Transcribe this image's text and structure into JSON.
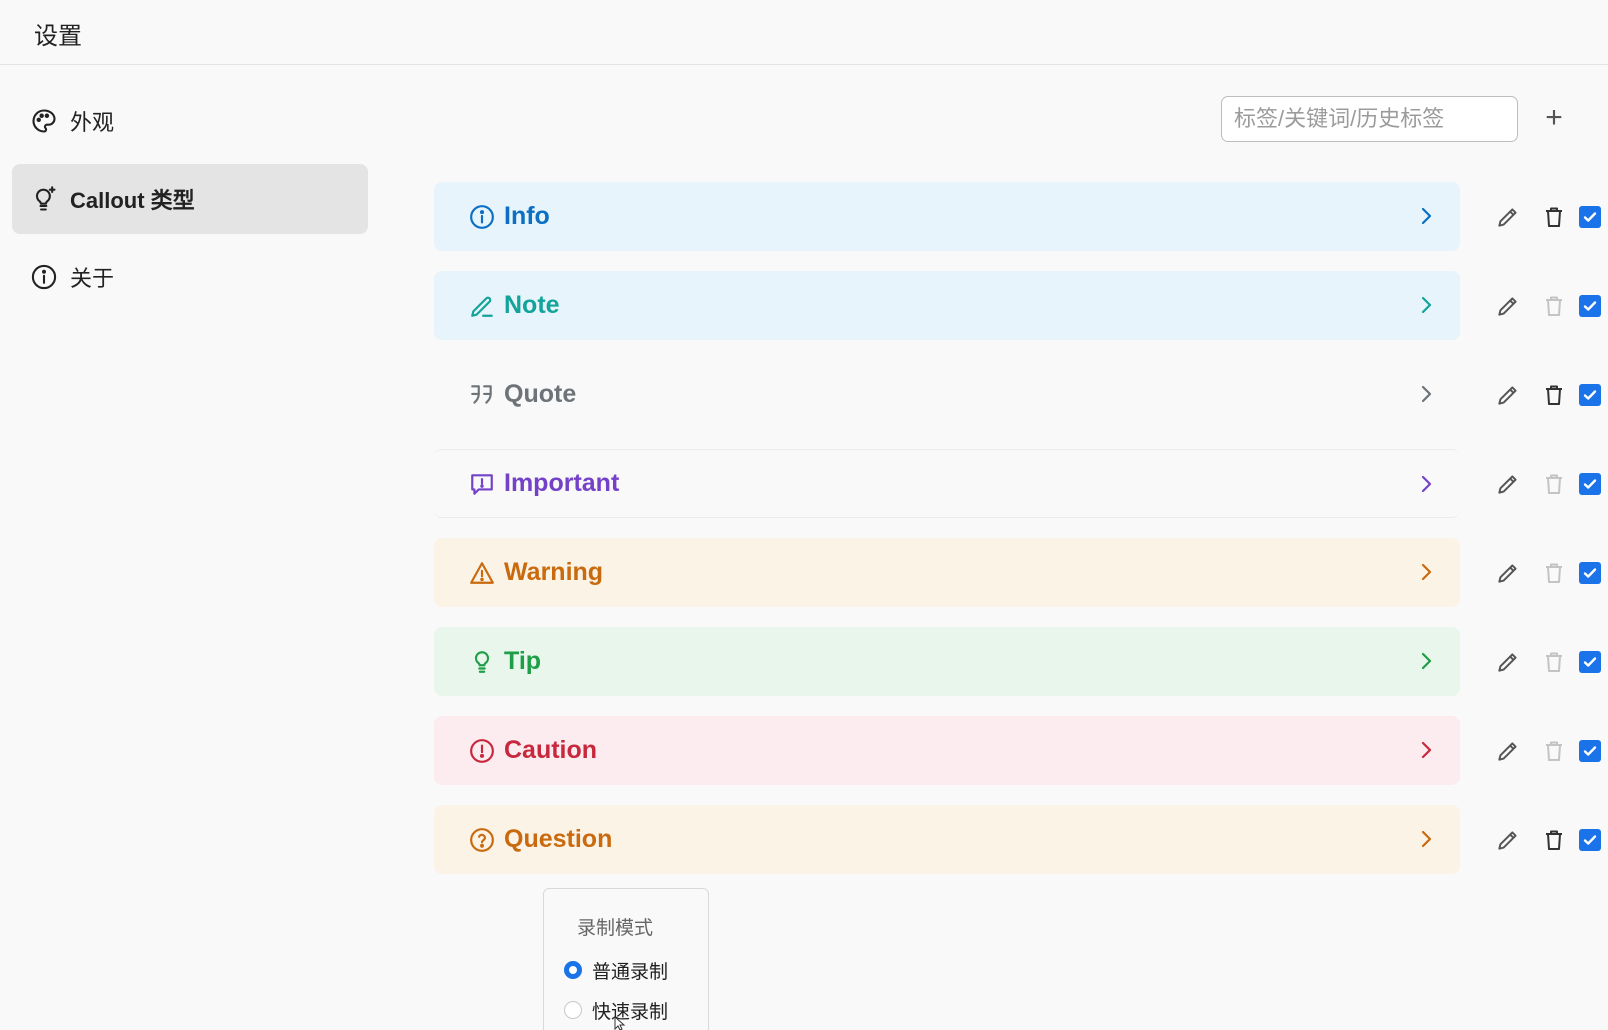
{
  "window": {
    "title": "设置"
  },
  "sidebar": {
    "items": [
      {
        "label": "外观",
        "icon": "palette-icon",
        "active": false
      },
      {
        "label": "Callout 类型",
        "icon": "lightbulb-sparkle-icon",
        "active": true
      },
      {
        "label": "关于",
        "icon": "info-icon",
        "active": false
      }
    ]
  },
  "search": {
    "placeholder": "标签/关键词/历史标签",
    "value": ""
  },
  "add_button": {
    "label": "+"
  },
  "callouts": [
    {
      "label": "Info",
      "icon": "info-circle-icon",
      "color": "#0b6fc4",
      "bg": "#e7f4fb",
      "delete_enabled": true,
      "checked": true
    },
    {
      "label": "Note",
      "icon": "pencil-icon",
      "color": "#12a39a",
      "bg": "#e7f4fb",
      "delete_enabled": false,
      "checked": true
    },
    {
      "label": "Quote",
      "icon": "quote-icon",
      "color": "#6d7378",
      "bg": "#f9f9f9",
      "delete_enabled": true,
      "checked": true
    },
    {
      "label": "Important",
      "icon": "message-alert-icon",
      "color": "#7442c8",
      "bg": "#f9f9f9",
      "delete_enabled": false,
      "checked": true
    },
    {
      "label": "Warning",
      "icon": "warning-triangle-icon",
      "color": "#c96a0e",
      "bg": "#fcf3e7",
      "delete_enabled": false,
      "checked": true
    },
    {
      "label": "Tip",
      "icon": "lightbulb-icon",
      "color": "#1e9e47",
      "bg": "#e9f6ec",
      "delete_enabled": false,
      "checked": true
    },
    {
      "label": "Caution",
      "icon": "alert-circle-icon",
      "color": "#c8283d",
      "bg": "#fcecef",
      "delete_enabled": false,
      "checked": true
    },
    {
      "label": "Question",
      "icon": "question-circle-icon",
      "color": "#c96a0e",
      "bg": "#fcf3e7",
      "delete_enabled": true,
      "checked": true
    }
  ],
  "record_popup": {
    "title": "录制模式",
    "options": [
      {
        "label": "普通录制",
        "selected": true
      },
      {
        "label": "快速录制",
        "selected": false
      }
    ]
  },
  "colors": {
    "accent": "#1a73e8",
    "icon_gray": "#555555",
    "icon_disabled": "#c4c4c4"
  }
}
